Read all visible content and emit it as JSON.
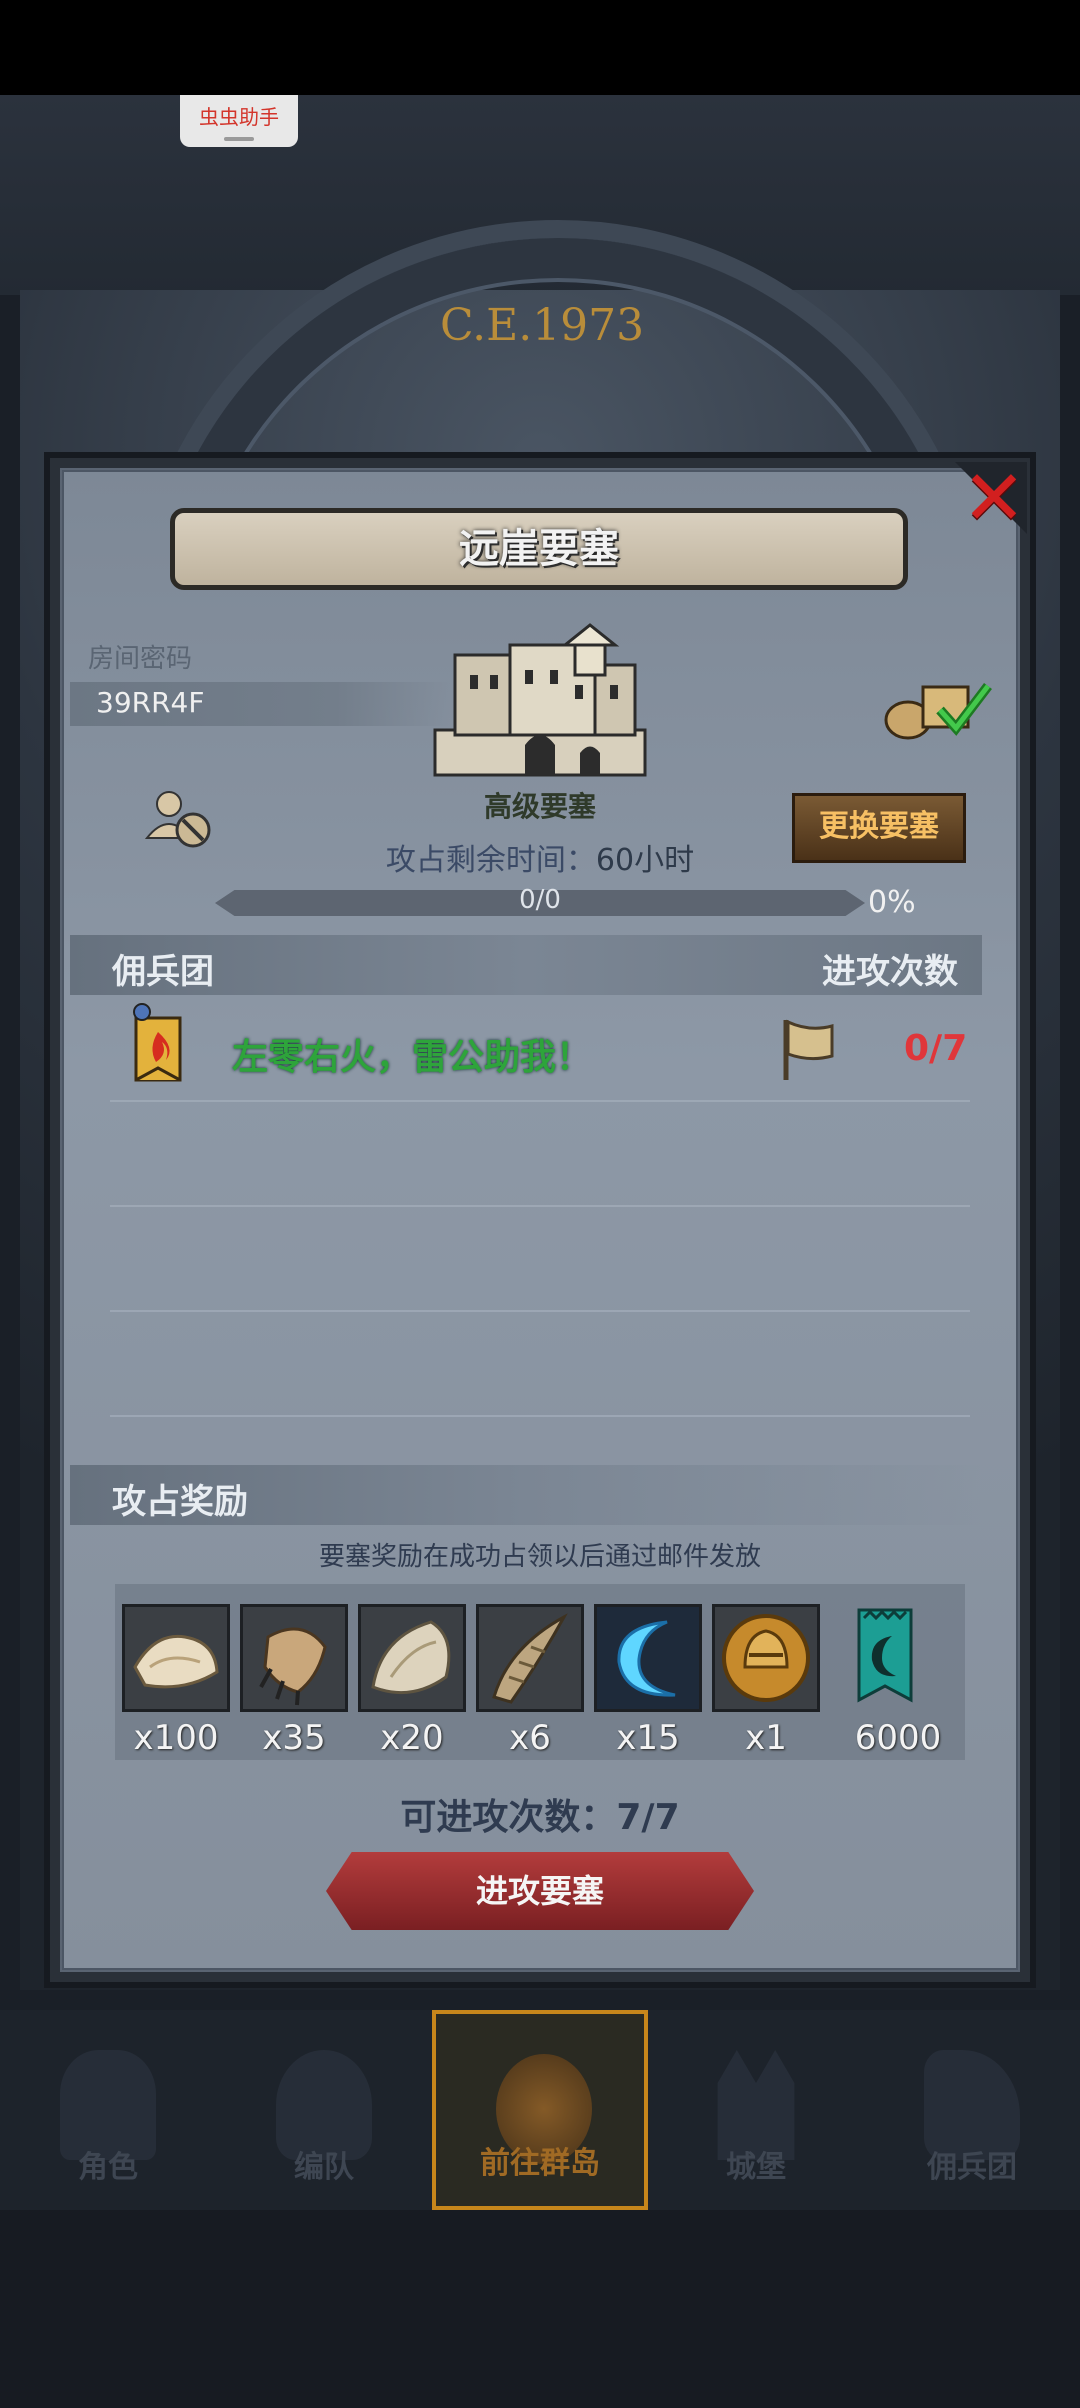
{
  "overlay": {
    "helper_tag": "虫虫助手"
  },
  "background": {
    "year": "C.E.1973"
  },
  "panel": {
    "title": "远崖要塞",
    "room_code_label": "房间密码",
    "room_code": "39RR4F",
    "fortress_level": "高级要塞",
    "change_button": "更换要塞",
    "remaining_time_label": "攻占剩余时间：",
    "remaining_time_value": "60",
    "remaining_time_unit": "小时",
    "progress_text": "0/0",
    "progress_percent": "0%",
    "progress_fraction": 0,
    "mercenary_header": "佣兵团",
    "attack_count_header": "进攻次数",
    "mercenary_rows": [
      {
        "name": "左零右火，雷公助我！",
        "attack_count": "0/7"
      }
    ],
    "reward_header": "攻占奖励",
    "reward_note": "要塞奖励在成功占领以后通过邮件发放",
    "rewards": [
      {
        "icon": "fur-icon",
        "qty": "x100"
      },
      {
        "icon": "claw-icon",
        "qty": "x35"
      },
      {
        "icon": "pelt-icon",
        "qty": "x20"
      },
      {
        "icon": "horn-icon",
        "qty": "x6"
      },
      {
        "icon": "crescent-icon",
        "qty": "x15"
      },
      {
        "icon": "helmet-coin-icon",
        "qty": "x1"
      },
      {
        "icon": "guild-banner-icon",
        "qty": "6000"
      }
    ],
    "attacks_remaining": "可进攻次数：7/7",
    "attack_button": "进攻要塞"
  },
  "nav": {
    "items": [
      {
        "label": "角色",
        "icon": "knight-icon"
      },
      {
        "label": "编队",
        "icon": "formation-icon"
      },
      {
        "label": "前往群岛",
        "icon": "globe-icon"
      },
      {
        "label": "城堡",
        "icon": "castle-icon"
      },
      {
        "label": "佣兵团",
        "icon": "mercenary-icon"
      }
    ],
    "active_index": 2
  },
  "colors": {
    "guild_name": "#2ea43b",
    "attack_count": "#e0363a",
    "change_button_text": "#f7c064",
    "close": "#d21f1f"
  }
}
